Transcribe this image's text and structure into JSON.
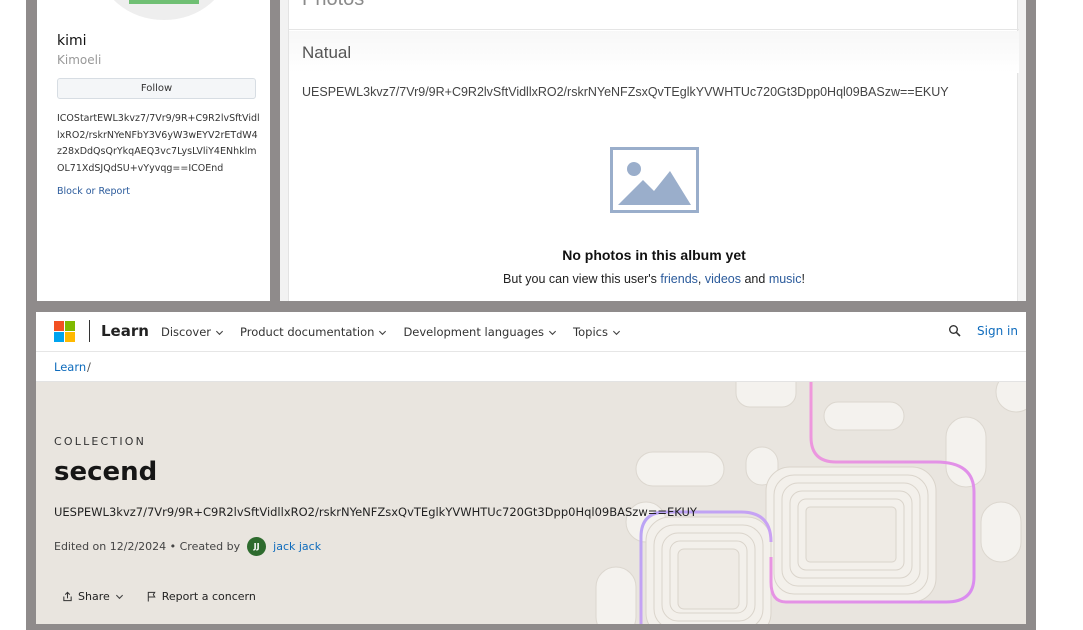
{
  "profile": {
    "name": "kimi",
    "handle": "Kimoeli",
    "follow_label": "Follow",
    "code_text": "ICOStartEWL3kvz7/7Vr9/9R+C9R2lvSftVidllxRO2/rskrNYeNFbY3V6yW3wEYV2rETdW4z28xDdQsQrYkqAEQ3vc7LysLVliY4ENhklmOL71XdSJQdSU+vYyvqg==ICOEnd",
    "block_report": "Block or Report"
  },
  "album": {
    "section_heading": "Photos",
    "title": "Natual",
    "code_text": "UESPEWL3kvz7/7Vr9/9R+C9R2lvSftVidllxRO2/rskrNYeNFZsxQvTEglkYVWHTUc720Gt3Dpp0Hql09BASzw==EKUY",
    "empty_title": "No photos in this album yet",
    "empty_prefix": "But you can view this user's ",
    "link_friends": "friends",
    "sep_comma": ", ",
    "link_videos": "videos",
    "sep_and": " and ",
    "link_music": "music",
    "empty_suffix": "!",
    "placeholder_icon": "image-icon"
  },
  "learn": {
    "brand": "Learn",
    "nav": [
      {
        "label": "Discover"
      },
      {
        "label": "Product documentation"
      },
      {
        "label": "Development languages"
      },
      {
        "label": "Topics"
      }
    ],
    "sign_in": "Sign in",
    "breadcrumb_root": "Learn",
    "breadcrumb_sep": "/",
    "eyebrow": "COLLECTION",
    "title": "secend",
    "code_text": "UESPEWL3kvz7/7Vr9/9R+C9R2lvSftVidllxRO2/rskrNYeNFZsxQvTEglkYVWHTUc720Gt3Dpp0Hql09BASzw==EKUY",
    "edited": "Edited on 12/2/2024 • Created by",
    "author_initials": "JJ",
    "author": "jack jack",
    "share": "Share",
    "report": "Report a concern",
    "colors": {
      "accent": "#0f6cbd",
      "hero_bg": "#e9e5df",
      "logo_red": "#f25022",
      "logo_green": "#7fba00",
      "logo_blue": "#00a4ef",
      "logo_yellow": "#ffb900"
    }
  },
  "icons": [
    "microsoft-logo",
    "chevron-down-icon",
    "search-icon",
    "share-icon",
    "flag-icon",
    "image-icon"
  ]
}
